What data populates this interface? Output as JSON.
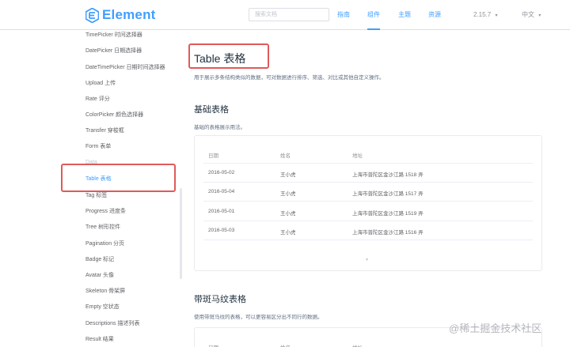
{
  "header": {
    "logo_text": "Element",
    "search_placeholder": "搜索文档",
    "nav": [
      "指南",
      "组件",
      "主题",
      "资源"
    ],
    "version": "2.15.7",
    "language": "中文"
  },
  "sidebar": {
    "items": [
      "TimePicker 时间选择器",
      "DatePicker 日期选择器",
      "DateTimePicker 日期时间选择器",
      "Upload 上传",
      "Rate 评分",
      "ColorPicker 颜色选择器",
      "Transfer 穿梭框",
      "Form 表单",
      "Data",
      "Table 表格",
      "Tag 标签",
      "Progress 进度条",
      "Tree 树形控件",
      "Pagination 分页",
      "Badge 标记",
      "Avatar 头像",
      "Skeleton 骨架屏",
      "Empty 空状态",
      "Descriptions 描述列表",
      "Result 结果"
    ],
    "active_index": 9
  },
  "main": {
    "title": "Table 表格",
    "description": "用于展示多条结构类似的数据，可对数据进行排序、筛选、对比或其他自定义操作。",
    "section1": {
      "title": "基础表格",
      "description": "基础的表格展示用法。",
      "columns": [
        "日期",
        "姓名",
        "地址"
      ],
      "rows": [
        [
          "2016-05-02",
          "王小虎",
          "上海市普陀区金沙江路 1518 弄"
        ],
        [
          "2016-05-04",
          "王小虎",
          "上海市普陀区金沙江路 1517 弄"
        ],
        [
          "2016-05-01",
          "王小虎",
          "上海市普陀区金沙江路 1519 弄"
        ],
        [
          "2016-05-03",
          "王小虎",
          "上海市普陀区金沙江路 1516 弄"
        ]
      ],
      "expand_glyph": "▾"
    },
    "section2": {
      "title": "带斑马纹表格",
      "description": "使用带斑马纹的表格，可以更容易区分出不同行的数据。",
      "columns": [
        "日期",
        "姓名",
        "地址"
      ]
    }
  },
  "watermark": "@稀土掘金技术社区",
  "colors": {
    "accent": "#409eff",
    "highlight_border": "#e05a5a",
    "text_primary": "#1f2f3d",
    "text_secondary": "#606266"
  }
}
